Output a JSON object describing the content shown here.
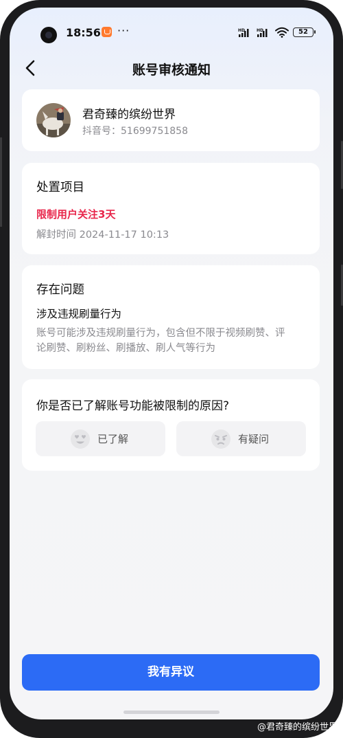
{
  "status_bar": {
    "time": "18:56",
    "more": "···",
    "signal_1": "HD",
    "signal_2": "HD",
    "battery": "52"
  },
  "nav": {
    "title": "账号审核通知"
  },
  "profile": {
    "name": "君奇臻的缤纷世界",
    "douyin_id": "抖音号：51699751858"
  },
  "action": {
    "title": "处置项目",
    "measure": "限制用户关注3天",
    "unblock_time": "解封时间 2024-11-17 10:13"
  },
  "problem": {
    "title": "存在问题",
    "issue": "涉及违规刷量行为",
    "description": "账号可能涉及违规刷量行为，包含但不限于视频刷赞、评论刷赞、刷粉丝、刷播放、刷人气等行为"
  },
  "feedback": {
    "question": "你是否已了解账号功能被限制的原因?",
    "understood": "已了解",
    "doubt": "有疑问"
  },
  "appeal": {
    "label": "我有异议"
  },
  "watermark": "@君奇臻的缤纷世界",
  "colors": {
    "accent": "#2c6bf5",
    "warning": "#e8264b",
    "background": "#f5f5f7"
  }
}
